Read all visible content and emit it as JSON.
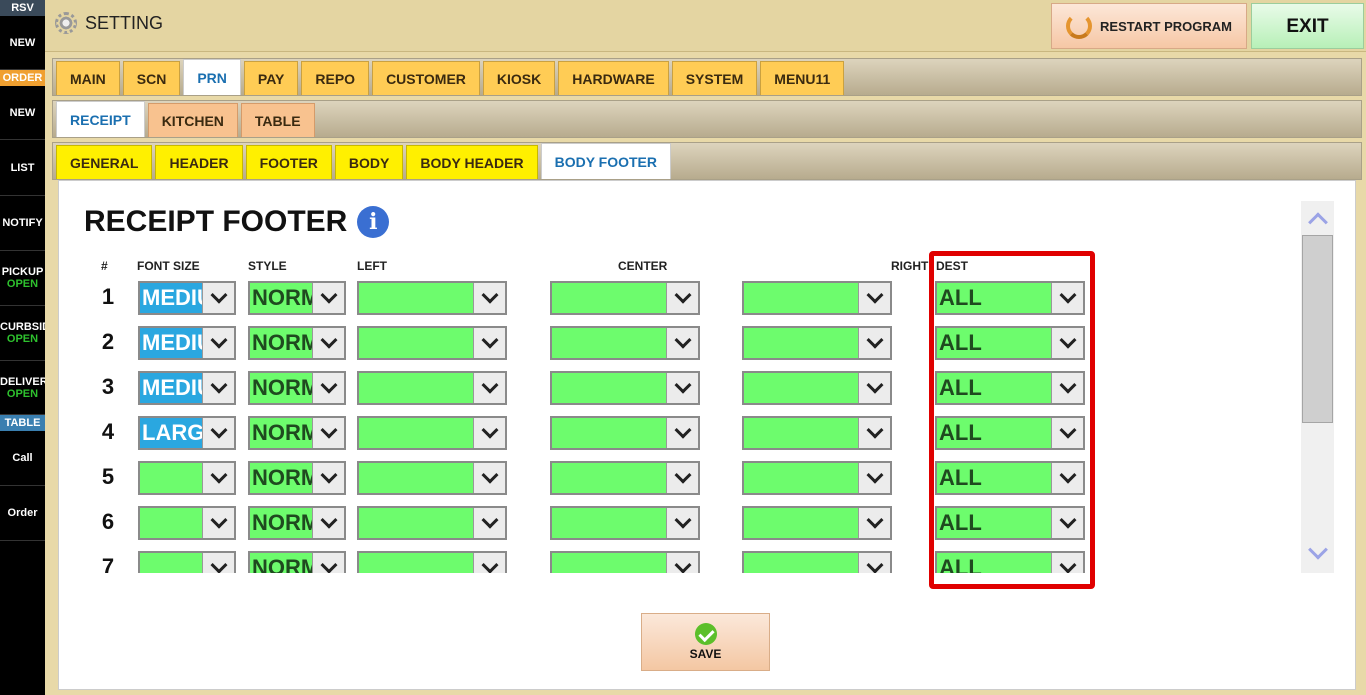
{
  "sidebar": {
    "rsv_header": "RSV",
    "rsv_new": "NEW",
    "order_header": "ORDER",
    "order_new": "NEW",
    "list": "LIST",
    "notify": "NOTIFY",
    "pickup": "PICKUP",
    "pickup_status": "OPEN",
    "curbside": "CURBSIDE",
    "curbside_status": "OPEN",
    "delivery": "DELIVERY",
    "delivery_status": "OPEN",
    "table_header": "TABLE",
    "call": "Call",
    "order": "Order"
  },
  "header": {
    "title": "SETTING",
    "restart_label": "RESTART PROGRAM",
    "exit_label": "EXIT"
  },
  "main_tabs": [
    "MAIN",
    "SCN",
    "PRN",
    "PAY",
    "REPO",
    "CUSTOMER",
    "KIOSK",
    "HARDWARE",
    "SYSTEM",
    "MENU11"
  ],
  "main_tab_active": "PRN",
  "sub_tabs": [
    "RECEIPT",
    "KITCHEN",
    "TABLE"
  ],
  "sub_tab_active": "RECEIPT",
  "section_tabs": [
    "GENERAL",
    "HEADER",
    "FOOTER",
    "BODY",
    "BODY HEADER",
    "BODY FOOTER"
  ],
  "section_tab_active": "BODY FOOTER",
  "panel": {
    "heading": "RECEIPT FOOTER",
    "info_glyph": "i",
    "columns": {
      "num": "#",
      "font_size": "FONT SIZE",
      "style": "STYLE",
      "left": "LEFT",
      "center": "CENTER",
      "right": "RIGHT",
      "dest": "DEST"
    },
    "rows": [
      {
        "num": "1",
        "font_size": "MEDIUM",
        "style": "NORMAL",
        "left": "",
        "center": "",
        "right": "",
        "dest": "ALL"
      },
      {
        "num": "2",
        "font_size": "MEDIUM",
        "style": "NORMAL",
        "left": "",
        "center": "",
        "right": "",
        "dest": "ALL"
      },
      {
        "num": "3",
        "font_size": "MEDIUM",
        "style": "NORMAL",
        "left": "",
        "center": "",
        "right": "",
        "dest": "ALL"
      },
      {
        "num": "4",
        "font_size": "LARGE",
        "style": "NORMAL",
        "left": "",
        "center": "",
        "right": "",
        "dest": "ALL"
      },
      {
        "num": "5",
        "font_size": "",
        "style": "NORMAL",
        "left": "",
        "center": "",
        "right": "",
        "dest": "ALL"
      },
      {
        "num": "6",
        "font_size": "",
        "style": "NORMAL",
        "left": "",
        "center": "",
        "right": "",
        "dest": "ALL"
      },
      {
        "num": "7",
        "font_size": "",
        "style": "NORMAL",
        "left": "",
        "center": "",
        "right": "",
        "dest": "ALL"
      }
    ],
    "save_label": "SAVE"
  },
  "colors": {
    "dropdown_green": "#6dfc6d",
    "font_size_blue": "#2aa7e0",
    "highlight_red": "#e00000",
    "tab_yellow": "#ffcc55",
    "active_tab_text": "#1a6fb0"
  }
}
